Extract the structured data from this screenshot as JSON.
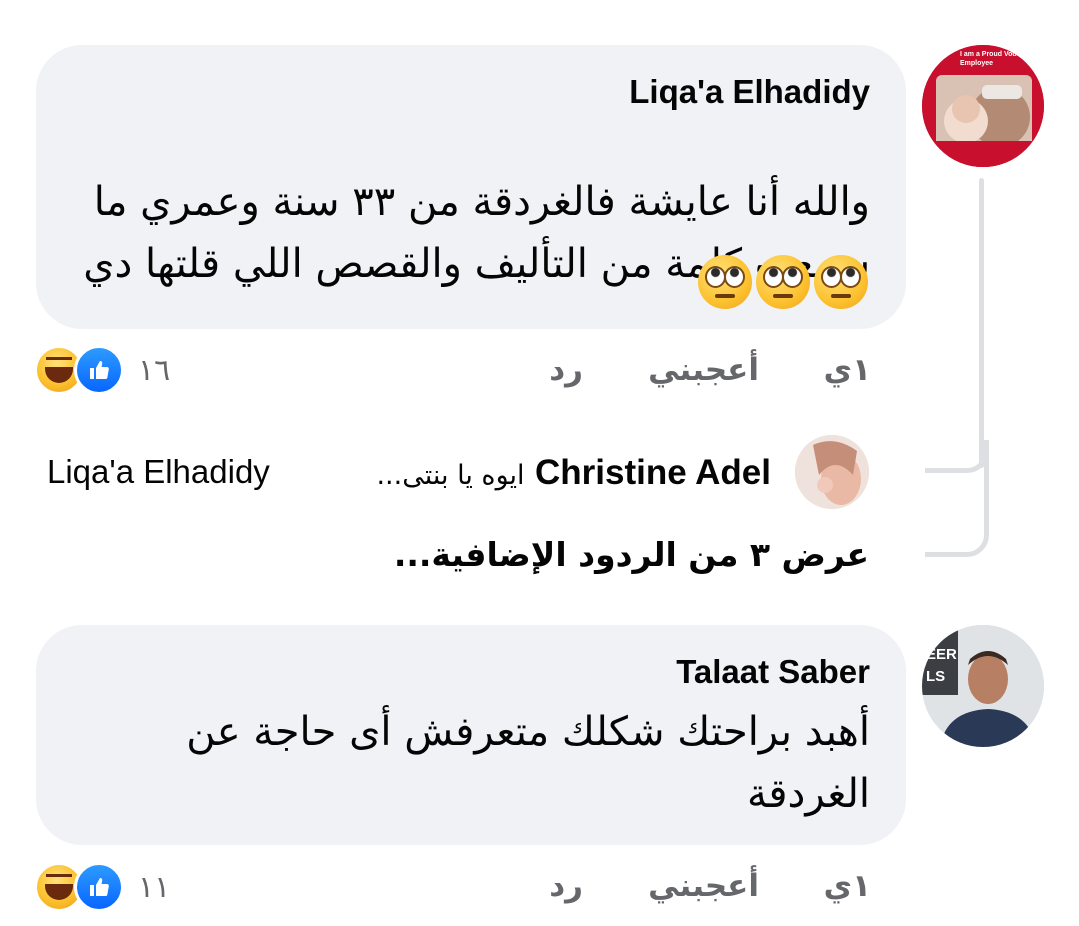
{
  "comments": [
    {
      "author": "Liqa'a Elhadidy",
      "avatar_text": "I am a Proud Vodafone Employee",
      "lines": [
        "والله أنا عايشة فالغردقة من ٣٣ سنة وعمري ما",
        "سمعت كلمة من التأليف والقصص اللي قلتها دي"
      ],
      "emoji": [
        "face-with-rolling-eyes",
        "face-with-rolling-eyes",
        "face-with-rolling-eyes"
      ],
      "actions": {
        "time": "١ي",
        "like": "أعجبني",
        "reply": "رد"
      },
      "reactions": {
        "count": "١٦",
        "icons": [
          "like-icon",
          "haha-icon"
        ]
      }
    },
    {
      "author": "Talaat Saber",
      "lines": [
        "أهبد براحتك شكلك متعرفش أى حاجة عن",
        "الغردقة"
      ],
      "actions": {
        "time": "١ي",
        "like": "أعجبني",
        "reply": "رد"
      },
      "reactions": {
        "count": "١١",
        "icons": [
          "like-icon",
          "haha-icon"
        ]
      }
    }
  ],
  "reply": {
    "author": "Christine Adel",
    "preview": "ايوه يا بنتى...",
    "mention": "Liqa'a Elhadidy"
  },
  "more_replies": "عرض ٣ من الردود الإضافية...",
  "colors": {
    "bubble": "#f0f2f5",
    "secondary_text": "#65676b",
    "like_blue": "#0866ff",
    "thread_line": "#dddfe2"
  }
}
